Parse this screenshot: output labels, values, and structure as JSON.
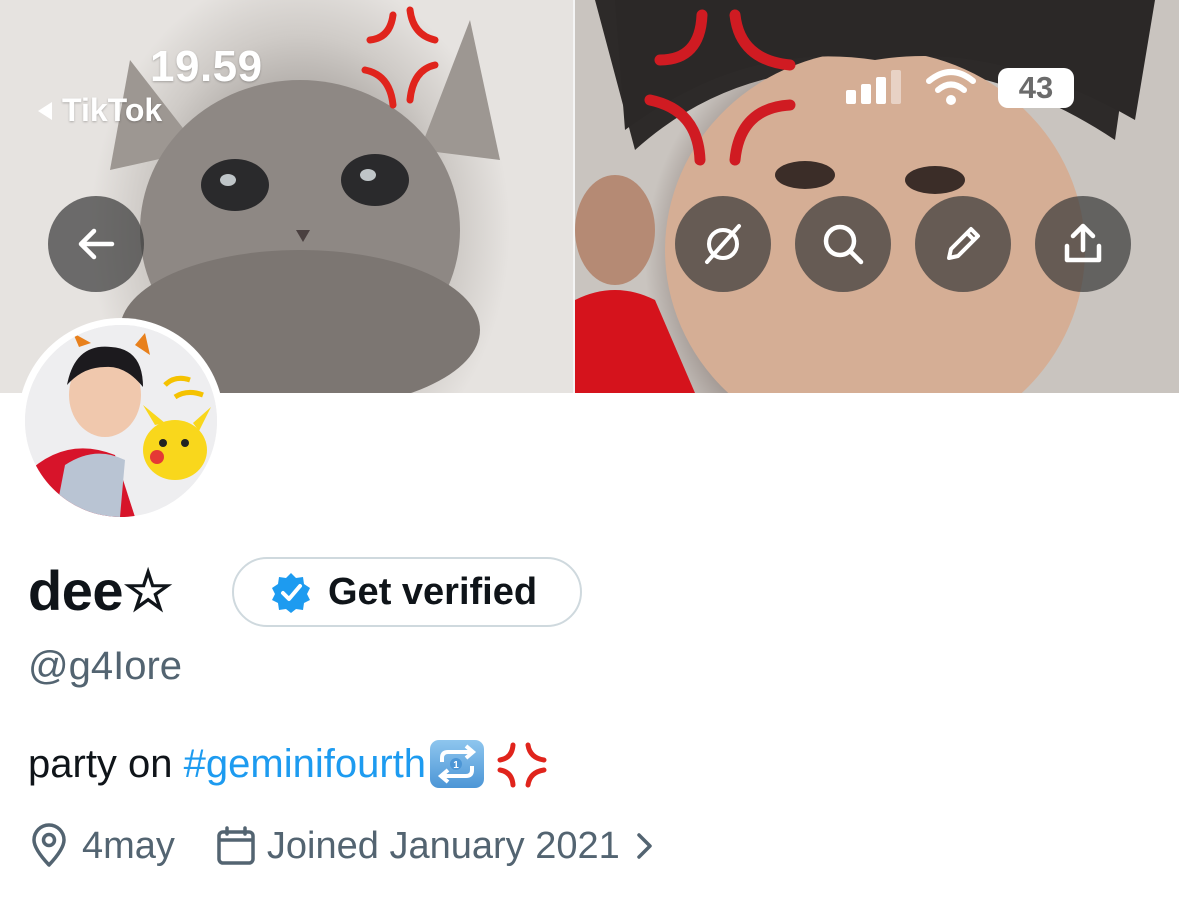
{
  "status_bar": {
    "time": "19.59",
    "back_app": "TikTok",
    "battery": "43"
  },
  "header": {
    "buttons": [
      {
        "name": "back",
        "icon": "arrow-left-icon"
      },
      {
        "name": "grok",
        "icon": "slashed-circle-icon"
      },
      {
        "name": "search",
        "icon": "search-icon"
      },
      {
        "name": "edit",
        "icon": "pencil-icon"
      },
      {
        "name": "share",
        "icon": "share-icon"
      }
    ]
  },
  "profile": {
    "display_name": "dee☆",
    "handle": "@g4Iore",
    "verify_button": "Get verified",
    "bio_prefix": "party on ",
    "bio_hashtag": "#geminifourth",
    "location": "4may",
    "joined": "Joined January 2021"
  },
  "colors": {
    "accent": "#1d9bf0",
    "secondary_text": "#536471",
    "primary_text": "#0f1419"
  }
}
